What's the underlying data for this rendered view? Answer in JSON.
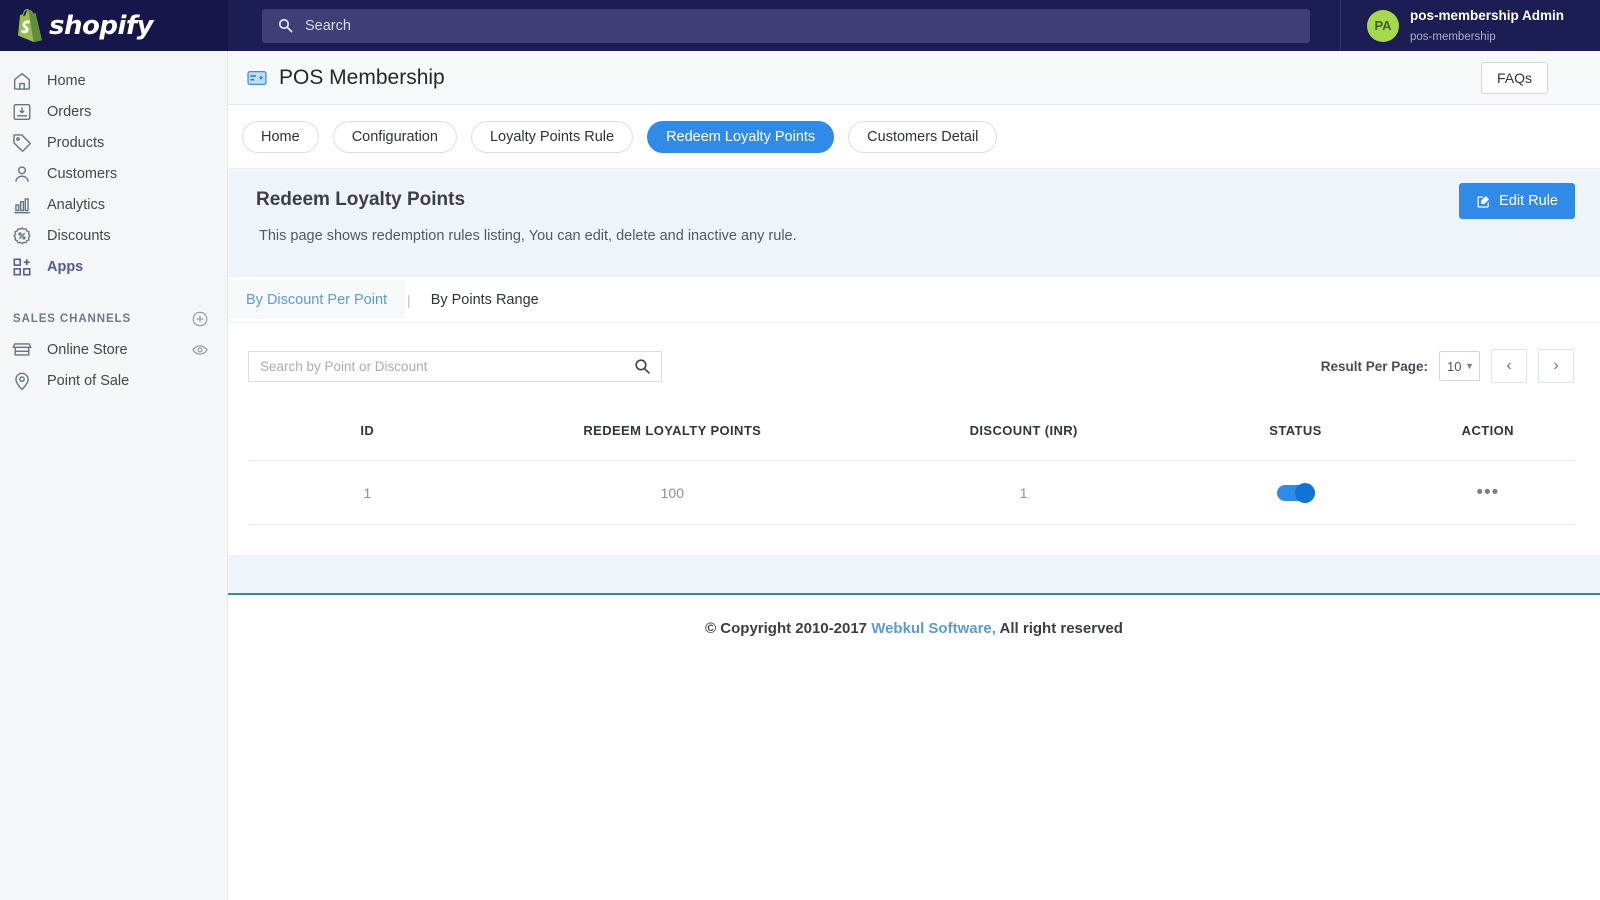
{
  "topbar": {
    "brand": "shopify",
    "search_placeholder": "Search",
    "user": {
      "initials": "PA",
      "name": "pos-membership Admin",
      "handle": "pos-membership"
    }
  },
  "sidebar": {
    "items": [
      {
        "label": "Home",
        "icon": "home-icon",
        "active": false
      },
      {
        "label": "Orders",
        "icon": "orders-icon",
        "active": false
      },
      {
        "label": "Products",
        "icon": "products-tag-icon",
        "active": false
      },
      {
        "label": "Customers",
        "icon": "customers-person-icon",
        "active": false
      },
      {
        "label": "Analytics",
        "icon": "analytics-bars-icon",
        "active": false
      },
      {
        "label": "Discounts",
        "icon": "discounts-percent-icon",
        "active": false
      },
      {
        "label": "Apps",
        "icon": "apps-grid-icon",
        "active": true
      }
    ],
    "section_title": "SALES CHANNELS",
    "add_channel_icon": "plus-circle-icon",
    "channels": [
      {
        "label": "Online Store",
        "icon": "store-icon",
        "trailing_icon": "eye-icon"
      },
      {
        "label": "Point of Sale",
        "icon": "location-pin-icon",
        "trailing_icon": ""
      }
    ]
  },
  "page": {
    "title": "POS Membership",
    "title_icon": "membership-card-icon",
    "faqs_label": "FAQs",
    "tabs": [
      {
        "label": "Home",
        "active": false
      },
      {
        "label": "Configuration",
        "active": false
      },
      {
        "label": "Loyalty Points Rule",
        "active": false
      },
      {
        "label": "Redeem Loyalty Points",
        "active": true
      },
      {
        "label": "Customers Detail",
        "active": false
      }
    ],
    "band": {
      "heading": "Redeem Loyalty Points",
      "description": "This page shows redemption rules listing, You can edit, delete and inactive any rule.",
      "edit_button": "Edit Rule",
      "edit_button_icon": "edit-square-icon"
    },
    "subtabs": [
      {
        "label": "By Discount Per Point",
        "active": true
      },
      {
        "label": "By Points Range",
        "active": false
      }
    ],
    "subtab_separator": "|",
    "toolbar": {
      "search_placeholder": "Search by Point or Discount",
      "search_value": "",
      "search_icon": "magnifier-icon",
      "result_per_page_label": "Result Per Page:",
      "result_per_page_value": "10",
      "prev_icon": "chevron-left-icon",
      "next_icon": "chevron-right-icon"
    },
    "table": {
      "columns": [
        "ID",
        "REDEEM LOYALTY POINTS",
        "DISCOUNT (INR)",
        "STATUS",
        "ACTION"
      ],
      "rows": [
        {
          "id": "1",
          "points": "100",
          "discount": "1",
          "status_on": true,
          "action_icon": "ellipsis-icon"
        }
      ]
    }
  },
  "footer": {
    "prefix": "© Copyright 2010-2017 ",
    "link": "Webkul Software,",
    "suffix": " All right reserved"
  },
  "colors": {
    "topbar": "#1c1d53",
    "accent_blue": "#2f8ae8",
    "band_bg": "#eff3fa",
    "sidebar_bg": "#f4f6f8",
    "apps_active": "#545a95",
    "avatar_green": "#a7d94c",
    "teal_rule": "#2d8ca0",
    "link_blue": "#5b9bd5"
  }
}
